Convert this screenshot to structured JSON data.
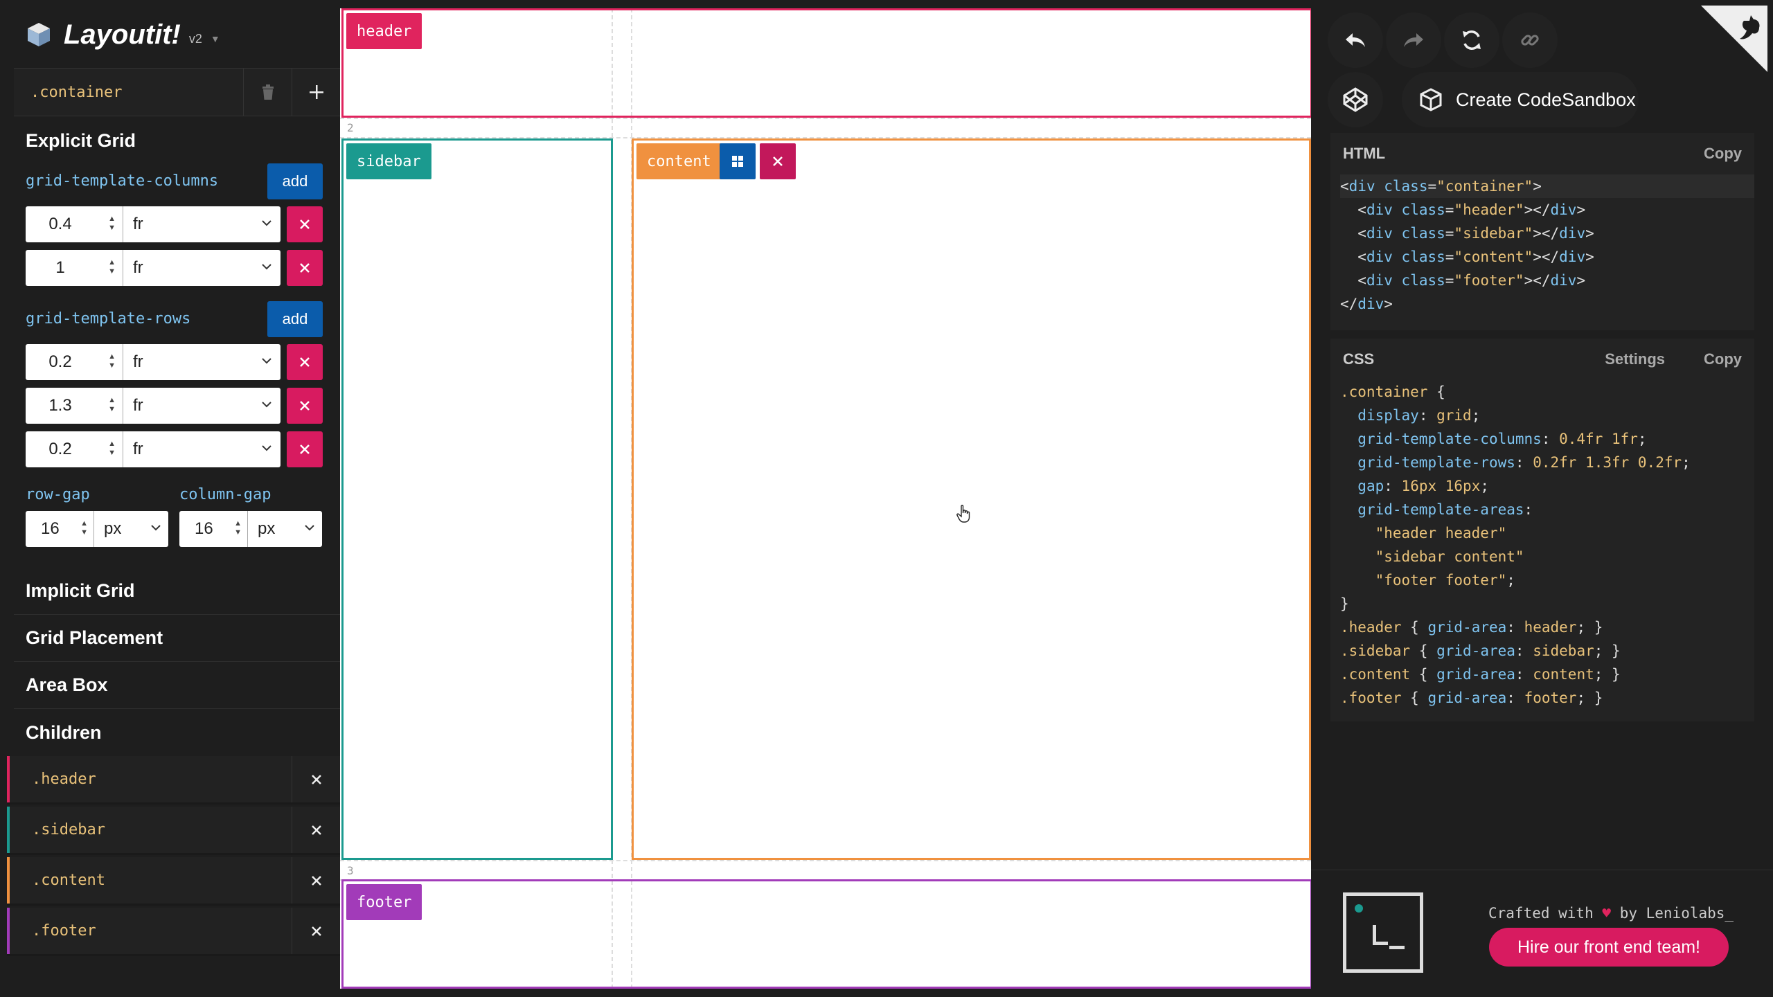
{
  "app": {
    "name": "Layoutit!",
    "version": "v2"
  },
  "container": {
    "name": ".container"
  },
  "explicit_grid": {
    "title": "Explicit Grid",
    "columns_label": "grid-template-columns",
    "rows_label": "grid-template-rows",
    "add_label": "add",
    "columns": [
      {
        "value": "0.4",
        "unit": "fr"
      },
      {
        "value": "1",
        "unit": "fr"
      }
    ],
    "rows": [
      {
        "value": "0.2",
        "unit": "fr"
      },
      {
        "value": "1.3",
        "unit": "fr"
      },
      {
        "value": "0.2",
        "unit": "fr"
      }
    ],
    "row_gap": {
      "label": "row-gap",
      "value": "16",
      "unit": "px"
    },
    "column_gap": {
      "label": "column-gap",
      "value": "16",
      "unit": "px"
    }
  },
  "sections": {
    "implicit": "Implicit Grid",
    "placement": "Grid Placement",
    "area_box": "Area Box",
    "children": "Children"
  },
  "children": [
    {
      "name": ".header",
      "color": "#e0245e"
    },
    {
      "name": ".sidebar",
      "color": "#1b9a8f"
    },
    {
      "name": ".content",
      "color": "#f0913f"
    },
    {
      "name": ".footer",
      "color": "#a23bb9"
    }
  ],
  "canvas": {
    "line_numbers": {
      "row2": "2",
      "row3": "3"
    },
    "areas": {
      "header": {
        "label": "header",
        "color": "#e0245e"
      },
      "sidebar": {
        "label": "sidebar",
        "color": "#1b9a8f"
      },
      "content": {
        "label": "content",
        "color": "#f0913f"
      },
      "footer": {
        "label": "footer",
        "color": "#a23bb9"
      }
    }
  },
  "right": {
    "codesandbox_label": "Create CodeSandbox",
    "html_title": "HTML",
    "css_title": "CSS",
    "copy_label": "Copy",
    "settings_label": "Settings",
    "crafted_text": "Crafted with",
    "heart": "♥",
    "by_text": "by Leniolabs_",
    "hire_label": "Hire our front end team!"
  }
}
